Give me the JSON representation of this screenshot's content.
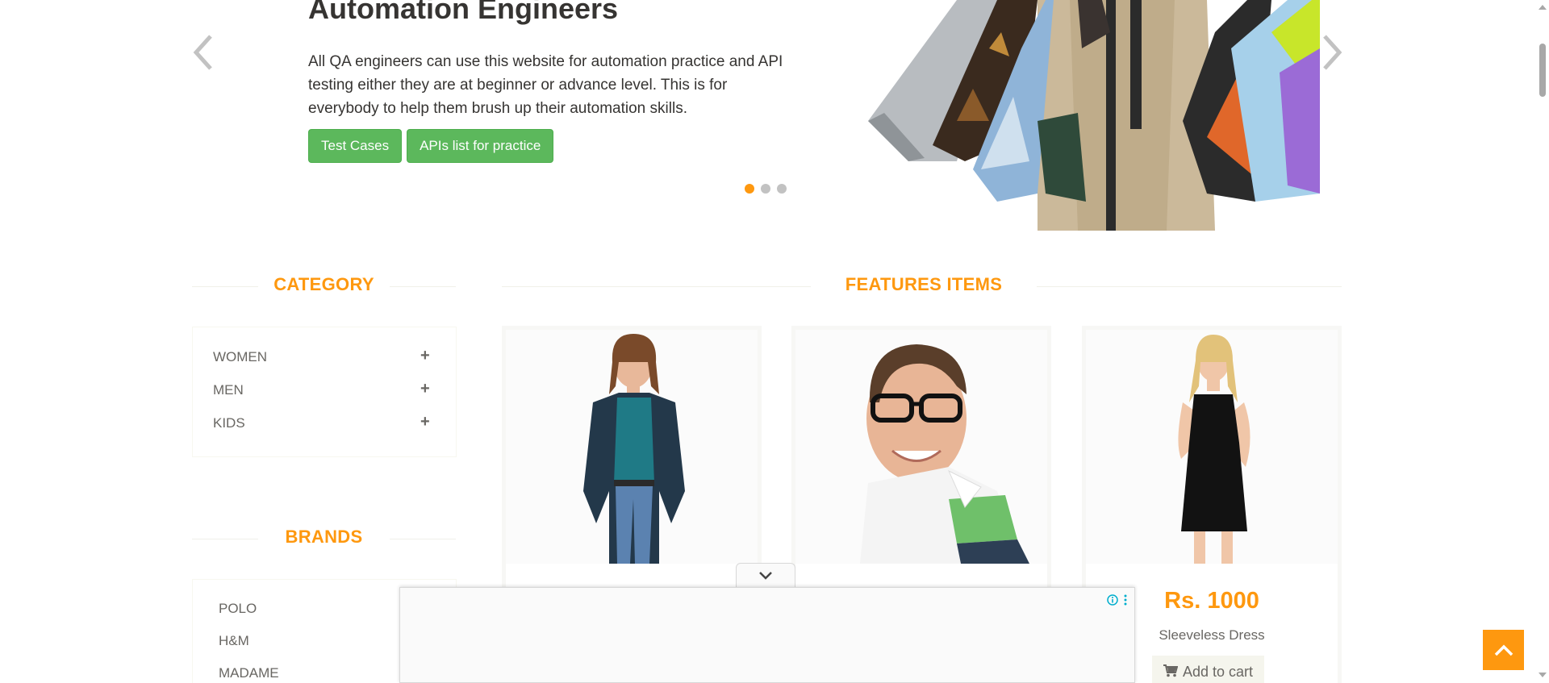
{
  "slider": {
    "title": "Automation Engineers",
    "text": "All QA engineers can use this website for automation practice and API testing either they are at beginner or advance level. This is for everybody to help them brush up their automation skills.",
    "buttons": [
      "Test Cases",
      "APIs list for practice"
    ],
    "active_dot": 1,
    "dot_count": 3
  },
  "sidebar": {
    "category_title": "CATEGORY",
    "categories": [
      "WOMEN",
      "MEN",
      "KIDS"
    ],
    "plus": "+",
    "brands_title": "BRANDS",
    "brands": [
      "POLO",
      "H&M",
      "MADAME"
    ]
  },
  "features": {
    "title": "FEATURES ITEMS",
    "products": [
      {
        "price": "",
        "name": "",
        "cart": ""
      },
      {
        "price": "",
        "name": "",
        "cart": ""
      },
      {
        "price": "Rs. 1000",
        "name": "Sleeveless Dress",
        "cart": "Add to cart"
      }
    ]
  },
  "colors": {
    "accent": "#fe980f",
    "green": "#5cb85c",
    "ad_icon": "#00aecd"
  }
}
